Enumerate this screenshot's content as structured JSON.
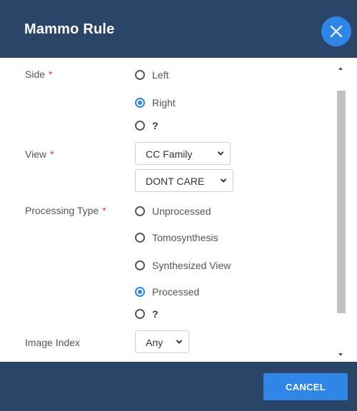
{
  "dialog": {
    "title": "Mammo Rule",
    "close_icon": "close-icon"
  },
  "form": {
    "side": {
      "label": "Side",
      "required_mark": "*",
      "options": [
        {
          "label": "Left",
          "checked": false
        },
        {
          "label": "Right",
          "checked": true
        },
        {
          "label": "?",
          "checked": false
        }
      ]
    },
    "view": {
      "label": "View",
      "required_mark": "*",
      "family_select": "CC Family",
      "modifier_select": "DONT CARE"
    },
    "processing_type": {
      "label": "Processing Type",
      "required_mark": "*",
      "options": [
        {
          "label": "Unprocessed",
          "checked": false
        },
        {
          "label": "Tomosynthesis",
          "checked": false
        },
        {
          "label": "Synthesized View",
          "checked": false
        },
        {
          "label": "Processed",
          "checked": true
        },
        {
          "label": "?",
          "checked": false
        }
      ]
    },
    "image_index": {
      "label": "Image Index",
      "select": "Any"
    }
  },
  "footer": {
    "cancel_label": "CANCEL"
  },
  "colors": {
    "header_bg": "#2a4568",
    "accent": "#2f86e6",
    "required": "#e0353b"
  }
}
